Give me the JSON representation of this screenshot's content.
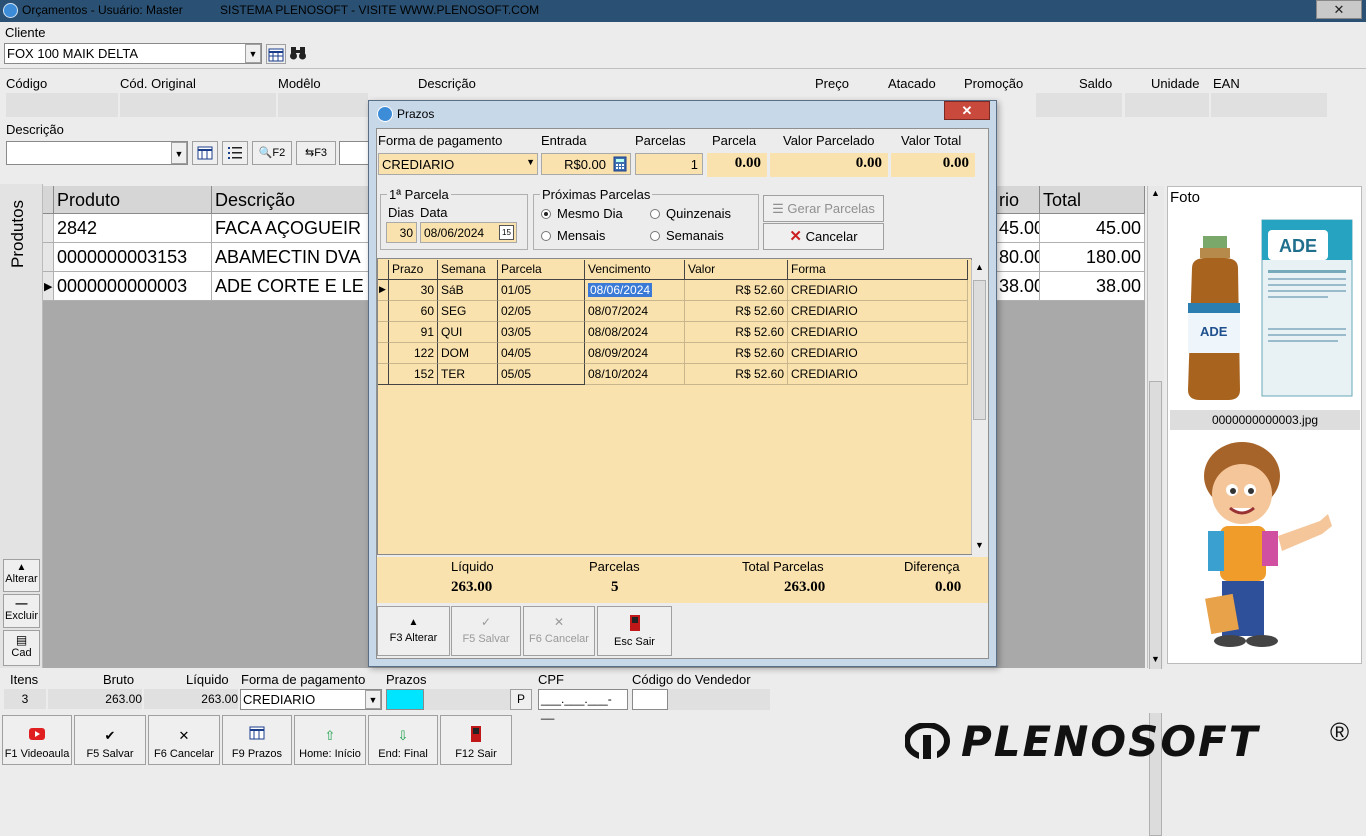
{
  "window": {
    "title": "Orçamentos - Usuário: Master",
    "subtitle": "SISTEMA PLENOSOFT - VISITE WWW.PLENOSOFT.COM",
    "close_label": "✕"
  },
  "cliente": {
    "label": "Cliente",
    "value": "FOX 100 MAIK DELTA"
  },
  "product_header": {
    "codigo": "Código",
    "cod_original": "Cód. Original",
    "modelo": "Modêlo",
    "descricao": "Descrição",
    "preco": "Preço",
    "atacado": "Atacado",
    "promocao": "Promoção",
    "saldo": "Saldo",
    "unidade": "Unidade",
    "ean": "EAN"
  },
  "search": {
    "descricao_label": "Descrição",
    "f2_label": "F2",
    "f3_label": "F3"
  },
  "sidebar": {
    "produtos_label": "Produtos",
    "alterar": "Alterar",
    "excluir": "Excluir",
    "cad": "Cad"
  },
  "grid": {
    "columns": [
      "Produto",
      "Descrição",
      "rio",
      "Total"
    ],
    "rows": [
      {
        "produto": "2842",
        "descricao": "FACA AÇOGUEIR",
        "col3": "45.00",
        "total": "45.00"
      },
      {
        "produto": "0000000003153",
        "descricao": "ABAMECTIN DVA",
        "col3": "80.00",
        "total": "180.00"
      },
      {
        "produto": "0000000000003",
        "descricao": "ADE CORTE E LE",
        "col3": "38.00",
        "total": "38.00"
      }
    ]
  },
  "foto": {
    "label": "Foto",
    "filename": "0000000000003.jpg",
    "product_brand": "ADE"
  },
  "dialog": {
    "title": "Prazos",
    "forma_pagamento_label": "Forma de pagamento",
    "forma_pagamento_value": "CREDIARIO",
    "entrada_label": "Entrada",
    "entrada_value": "R$0.00",
    "parcelas_label": "Parcelas",
    "parcelas_value": "1",
    "parcela_label": "Parcela",
    "parcela_value": "0.00",
    "valor_parcelado_label": "Valor Parcelado",
    "valor_parcelado_value": "0.00",
    "valor_total_label": "Valor Total",
    "valor_total_value": "0.00",
    "primeira_parcela_label": "1ª Parcela",
    "dias_label": "Dias",
    "data_label": "Data",
    "dias_value": "30",
    "data_value": "08/06/2024",
    "proximas_label": "Próximas Parcelas",
    "radio_mesmo_dia": "Mesmo Dia",
    "radio_quinzenais": "Quinzenais",
    "radio_mensais": "Mensais",
    "radio_semanais": "Semanais",
    "gerar_label": "Gerar Parcelas",
    "cancelar_label": "Cancelar",
    "columns": [
      "Prazo",
      "Semana",
      "Parcela",
      "Vencimento",
      "Valor",
      "Forma"
    ],
    "rows": [
      {
        "prazo": "30",
        "semana": "SáB",
        "parcela": "01/05",
        "vencimento": "08/06/2024",
        "valor": "R$ 52.60",
        "forma": "CREDIARIO"
      },
      {
        "prazo": "60",
        "semana": "SEG",
        "parcela": "02/05",
        "vencimento": "08/07/2024",
        "valor": "R$ 52.60",
        "forma": "CREDIARIO"
      },
      {
        "prazo": "91",
        "semana": "QUI",
        "parcela": "03/05",
        "vencimento": "08/08/2024",
        "valor": "R$ 52.60",
        "forma": "CREDIARIO"
      },
      {
        "prazo": "122",
        "semana": "DOM",
        "parcela": "04/05",
        "vencimento": "08/09/2024",
        "valor": "R$ 52.60",
        "forma": "CREDIARIO"
      },
      {
        "prazo": "152",
        "semana": "TER",
        "parcela": "05/05",
        "vencimento": "08/10/2024",
        "valor": "R$ 52.60",
        "forma": "CREDIARIO"
      }
    ],
    "summary": {
      "liquido_label": "Líquido",
      "liquido_value": "263.00",
      "parcelas_label": "Parcelas",
      "parcelas_value": "5",
      "total_parcelas_label": "Total Parcelas",
      "total_parcelas_value": "263.00",
      "diferenca_label": "Diferença",
      "diferenca_value": "0.00"
    },
    "buttons": {
      "f3": "F3 Alterar",
      "f5": "F5 Salvar",
      "f6": "F6 Cancelar",
      "esc": "Esc Sair"
    }
  },
  "bottom": {
    "itens_label": "Itens",
    "itens_value": "3",
    "bruto_label": "Bruto",
    "bruto_value": "263.00",
    "liquido_label": "Líquido",
    "liquido_value": "263.00",
    "forma_label": "Forma de pagamento",
    "forma_value": "CREDIARIO",
    "prazos_label": "Prazos",
    "prazos_btn": "P",
    "cpf_label": "CPF",
    "cpf_value": "___.___.___-__",
    "vendedor_label": "Código do Vendedor"
  },
  "footer_buttons": {
    "f1": "F1 Videoaula",
    "f5": "F5 Salvar",
    "f6": "F6 Cancelar",
    "f9": "F9 Prazos",
    "home": "Home: Início",
    "end": "End: Final",
    "f12": "F12 Sair"
  },
  "logo": {
    "text": "PLENOSOFT",
    "mark": "®"
  },
  "colors": {
    "titlebar": "#2a5173",
    "dialog_bg": "#f9e2ad",
    "accent": "#3d8cd8",
    "red": "#cc1f1f"
  }
}
